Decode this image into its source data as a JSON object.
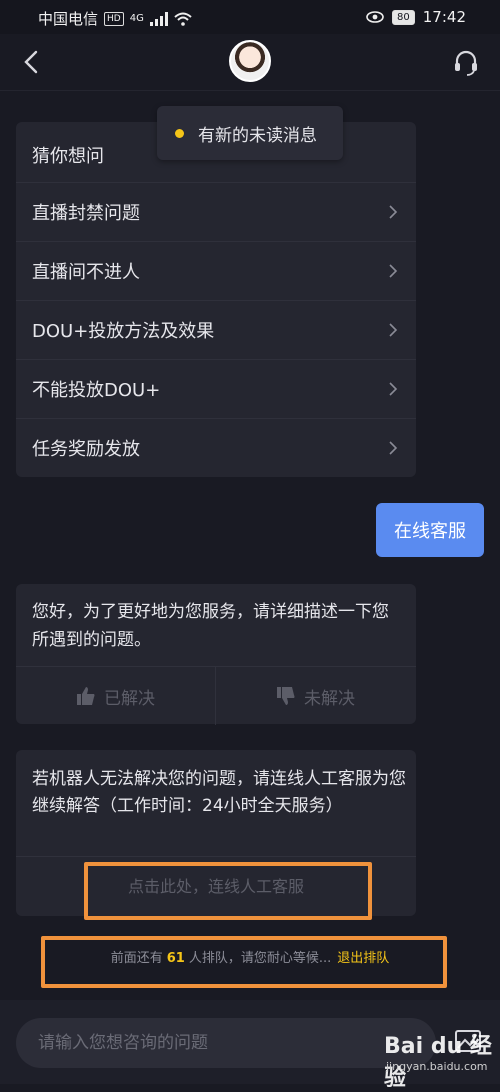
{
  "status_bar": {
    "carrier": "中国电信",
    "hd": "HD",
    "network": "4G",
    "battery": "80",
    "time": "17:42"
  },
  "menu": {
    "title": "猜你想问",
    "items": [
      {
        "label": "直播封禁问题"
      },
      {
        "label": "直播间不进人"
      },
      {
        "label": "DOU+投放方法及效果"
      },
      {
        "label": "不能投放DOU+"
      },
      {
        "label": "任务奖励发放"
      }
    ]
  },
  "toast": {
    "text": "有新的未读消息"
  },
  "user_message": {
    "text": "在线客服"
  },
  "bot_reply": {
    "text": "您好，为了更好地为您服务，请详细描述一下您所遇到的问题。",
    "resolved_label": "已解决",
    "unresolved_label": "未解决"
  },
  "human_service": {
    "text": "若机器人无法解决您的问题，请连线人工客服为您继续解答（工作时间：24小时全天服务）",
    "link_label": "点击此处，连线人工客服"
  },
  "queue": {
    "prefix": "前面还有",
    "count": "61",
    "suffix": "人排队，请您耐心等候...",
    "exit_label": "退出排队"
  },
  "input": {
    "placeholder": "请输入您想咨询的问题"
  },
  "watermark": {
    "brand": "Bai du 经验",
    "url": "jingyan.baidu.com"
  },
  "colors": {
    "accent_blue": "#5a8bf0",
    "highlight_yellow": "#f5c518",
    "annotation_orange": "#f0923c"
  }
}
